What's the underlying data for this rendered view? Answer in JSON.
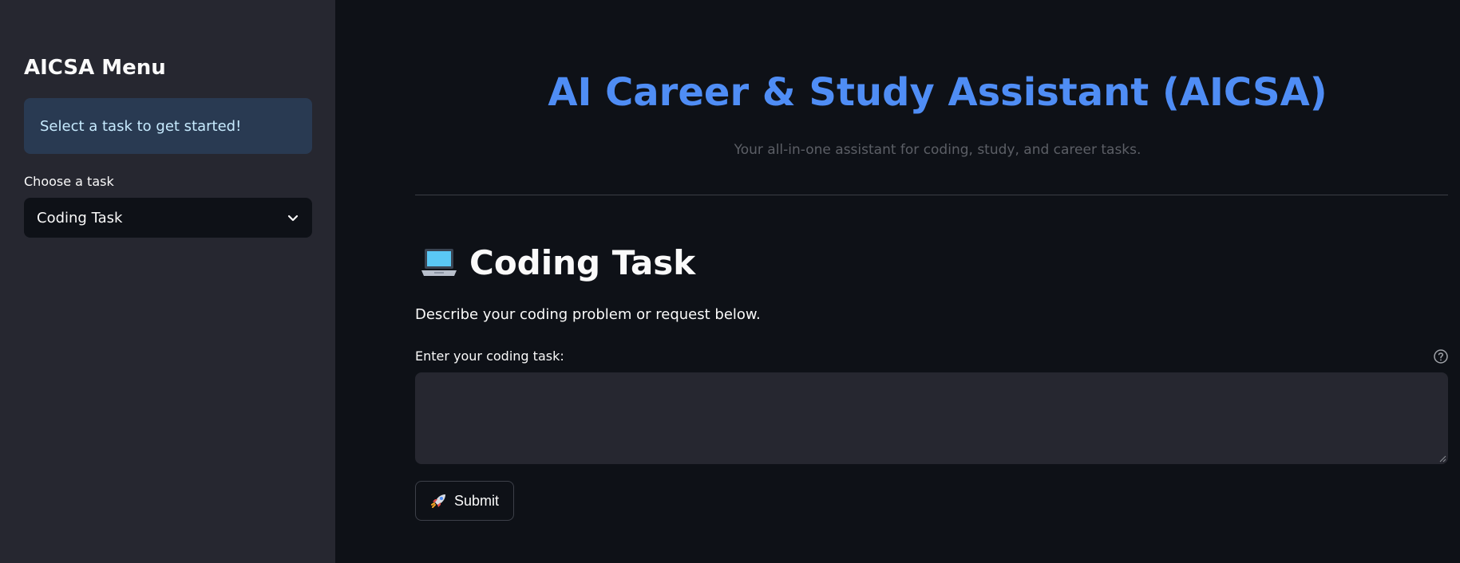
{
  "sidebar": {
    "title": "AICSA Menu",
    "info_text": "Select a task to get started!",
    "select_label": "Choose a task",
    "select_value": "Coding Task"
  },
  "main": {
    "title": "AI Career & Study Assistant (AICSA)",
    "subtitle": "Your all-in-one assistant for coding, study, and career tasks.",
    "section_title": "Coding Task",
    "section_icon": "laptop-icon",
    "description": "Describe your coding problem or request below.",
    "field_label": "Enter your coding task:",
    "field_value": "",
    "submit_label": "Submit",
    "submit_icon": "rocket-icon"
  },
  "colors": {
    "accent": "#4f8df5",
    "background": "#0e1117",
    "sidebar_bg": "#262730",
    "info_bg": "#293a52"
  }
}
